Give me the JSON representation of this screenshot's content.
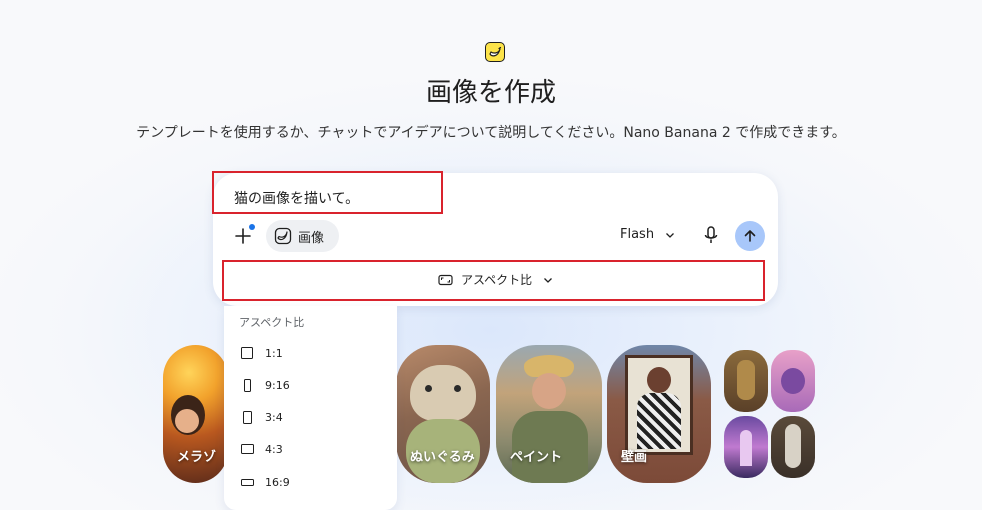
{
  "header": {
    "logo_icon": "banana-icon",
    "title": "画像を作成",
    "subtitle": "テンプレートを使用するか、チャットでアイデアについて説明してください。Nano Banana 2 で作成できます。"
  },
  "composer": {
    "prompt_text": "猫の画像を描いて。",
    "image_chip_label": "画像",
    "model_label": "Flash",
    "aspect_label": "アスペクト比"
  },
  "aspect_menu": {
    "header": "アスペクト比",
    "options": [
      {
        "label": "1:1"
      },
      {
        "label": "9:16"
      },
      {
        "label": "3:4"
      },
      {
        "label": "4:3"
      },
      {
        "label": "16:9"
      }
    ]
  },
  "templates": [
    {
      "label": "メラゾ"
    },
    {
      "label": "ぬいぐるみ"
    },
    {
      "label": "ペイント"
    },
    {
      "label": "壁画"
    }
  ],
  "colors": {
    "accent_blue": "#1a73e8",
    "send_button": "#a8c7fa",
    "highlight_red": "#d9232d",
    "logo_yellow": "#fde44a"
  }
}
